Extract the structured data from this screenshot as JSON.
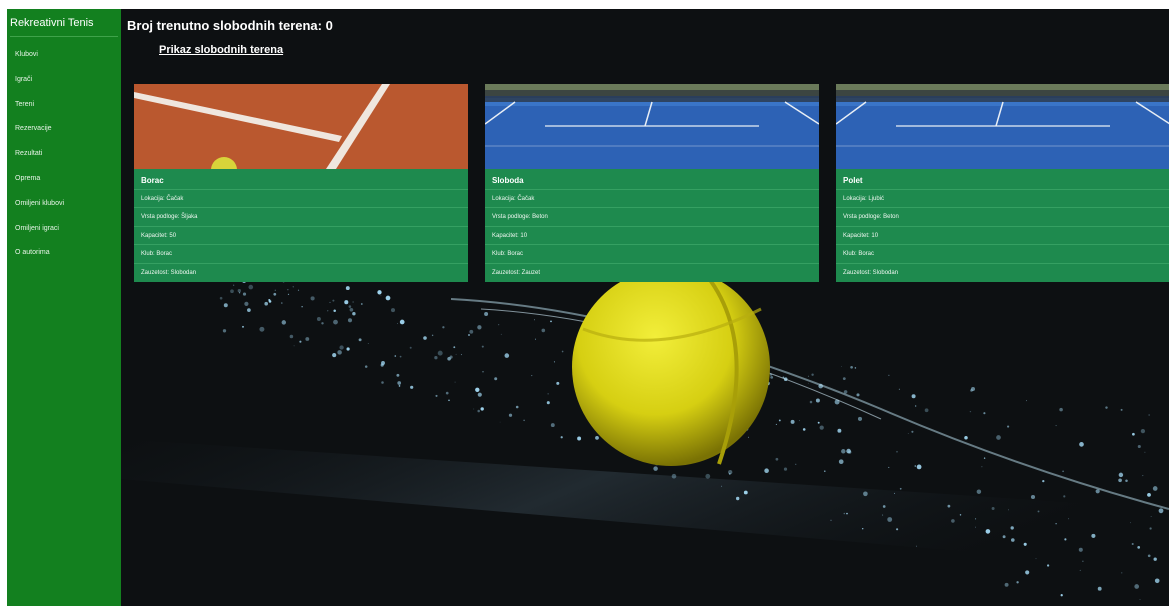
{
  "sidebar": {
    "brand": "Rekreativni Tenis",
    "items": [
      {
        "label": "Klubovi"
      },
      {
        "label": "Igrači"
      },
      {
        "label": "Tereni"
      },
      {
        "label": "Rezervacije"
      },
      {
        "label": "Rezultati"
      },
      {
        "label": "Oprema"
      },
      {
        "label": "Omiljeni klubovi"
      },
      {
        "label": "Omiljeni igraci"
      },
      {
        "label": "O autorima"
      }
    ]
  },
  "main": {
    "title": "Broj trenutno slobodnih terena: 0",
    "link_label": "Prikaz slobodnih terena",
    "courts": [
      {
        "name": "Borac",
        "lokacija": "Lokacija: Čačak",
        "podloga": "Vrsta podloge: Šljaka",
        "kapacitet": "Kapacitet: 50",
        "klub": "Klub: Borac",
        "zauzetost": "Zauzetost: Slobodan",
        "image": "clay-court-image"
      },
      {
        "name": "Sloboda",
        "lokacija": "Lokacija: Čačak",
        "podloga": "Vrsta podloge: Beton",
        "kapacitet": "Kapacitet: 10",
        "klub": "Klub: Borac",
        "zauzetost": "Zauzetost: Zauzet",
        "image": "hard-court-image"
      },
      {
        "name": "Polet",
        "lokacija": "Lokacija: Ljubić",
        "podloga": "Vrsta podloge: Beton",
        "kapacitet": "Kapacitet: 10",
        "klub": "Klub: Borac",
        "zauzetost": "Zauzetost: Slobodan",
        "image": "hard-court-image"
      }
    ]
  },
  "colors": {
    "sidebar": "#13801f",
    "card": "#1e8a4e",
    "background": "#0d1012",
    "ball": "#e2dc1c"
  }
}
